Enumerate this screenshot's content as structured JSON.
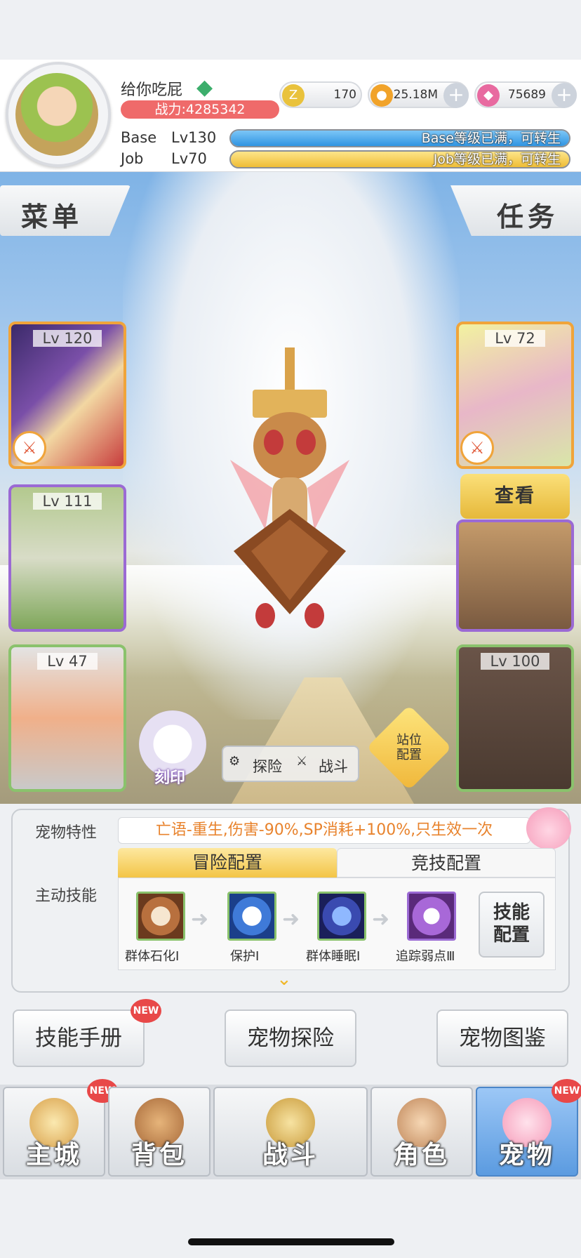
{
  "player": {
    "name": "给你吃屁",
    "power": "战力:4285342",
    "base_label": "Base",
    "base_level": "Lv130",
    "base_status": "Base等级已满，可转生",
    "job_label": "Job",
    "job_level": "Lv70",
    "job_status": "Job等级已满，可转生"
  },
  "currencies": {
    "zeny_icon": "Z",
    "zeny": "170",
    "gold": "25.18M",
    "gem": "75689"
  },
  "tabs": {
    "menu": "菜单",
    "quest": "任务"
  },
  "pets_left": [
    {
      "level": "Lv 120"
    },
    {
      "level": "Lv 111"
    },
    {
      "level": "Lv 47"
    }
  ],
  "pets_right": [
    {
      "level": "Lv 72"
    },
    {
      "level": "Lv 100"
    }
  ],
  "view_button": "查看",
  "controls": {
    "engrave": "刻印",
    "explore": "探险",
    "battle": "战斗",
    "station_1": "站位",
    "station_2": "配置"
  },
  "panel": {
    "trait_label": "宠物特性",
    "trait_text": "亡语-重生,伤害-90%,SP消耗+100%,只生效一次",
    "skill_label": "主动技能",
    "config_tabs": [
      "冒险配置",
      "竞技配置"
    ],
    "skills": [
      {
        "name": "群体石化Ⅰ"
      },
      {
        "name": "保护Ⅰ"
      },
      {
        "name": "群体睡眠Ⅰ"
      },
      {
        "name": "追踪弱点Ⅲ"
      }
    ],
    "skill_config_1": "技能",
    "skill_config_2": "配置"
  },
  "actions": {
    "manual": "技能手册",
    "explore": "宠物探险",
    "codex": "宠物图鉴",
    "new_badge": "NEW"
  },
  "nav": {
    "items": [
      {
        "label": "主城"
      },
      {
        "label": "背包"
      },
      {
        "label": "战斗"
      },
      {
        "label": "角色"
      },
      {
        "label": "宠物"
      }
    ],
    "new_badge": "NEW"
  },
  "colors": {
    "power_bg": "#ef6a6a",
    "base_bar": "#3aa5ec",
    "job_bar": "#f3c94a",
    "trait_text": "#e8832d",
    "active_tab": "#f3c547",
    "nav_selected": "#5b9be0"
  }
}
